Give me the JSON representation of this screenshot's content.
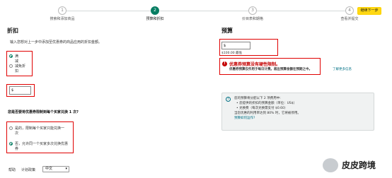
{
  "stepper": {
    "steps": [
      {
        "num": "1",
        "label": "搜索和添加商品"
      },
      {
        "num": "2",
        "label": "预算和折扣"
      },
      {
        "num": "3",
        "label": "价目表和期格"
      },
      {
        "num": "4",
        "label": "查看并提交"
      }
    ],
    "active_index": 1
  },
  "continue_button": "继续下一步",
  "discount": {
    "title": "折扣",
    "description": "输入您想对上一步中添加至优惠券的商品应用的折扣金额。",
    "options": [
      "满",
      "减",
      "减免折",
      "扣"
    ],
    "amount_prefix": "$",
    "amount_value": ""
  },
  "redeem": {
    "question": "您是否要将优惠券限制到每个买家兑换 1 次?",
    "option_yes": "是的，限制每个买家只能兑换一",
    "option_yes_cont": "次",
    "option_no": "否，允许同一个买家多次兑换优惠",
    "option_no_cont": "券"
  },
  "budget": {
    "title": "预算",
    "prefix": "$",
    "value": "",
    "hint": "$100.00 最低"
  },
  "warning": {
    "title": "优惠券预算没有硬性限制。",
    "desc": "优惠券预算仅作用于每日计费。超出预算金额在预期之中。",
    "link": "了解更多信息"
  },
  "info": {
    "line1": "您的预算将分配以下 2 项费用中:",
    "bullet1": "• 您提供的折扣的预算金额（单位：US$）",
    "bullet2": "• 兑换费（每次兑换需支付 $0.60）",
    "line2": "当您优惠的利用率达到 80% 时，它将被停用。",
    "link": "预算如何运作?"
  },
  "footer": {
    "help": "帮助",
    "policy": "计划政策",
    "language": "中文"
  },
  "watermark": "皮皮跨境"
}
